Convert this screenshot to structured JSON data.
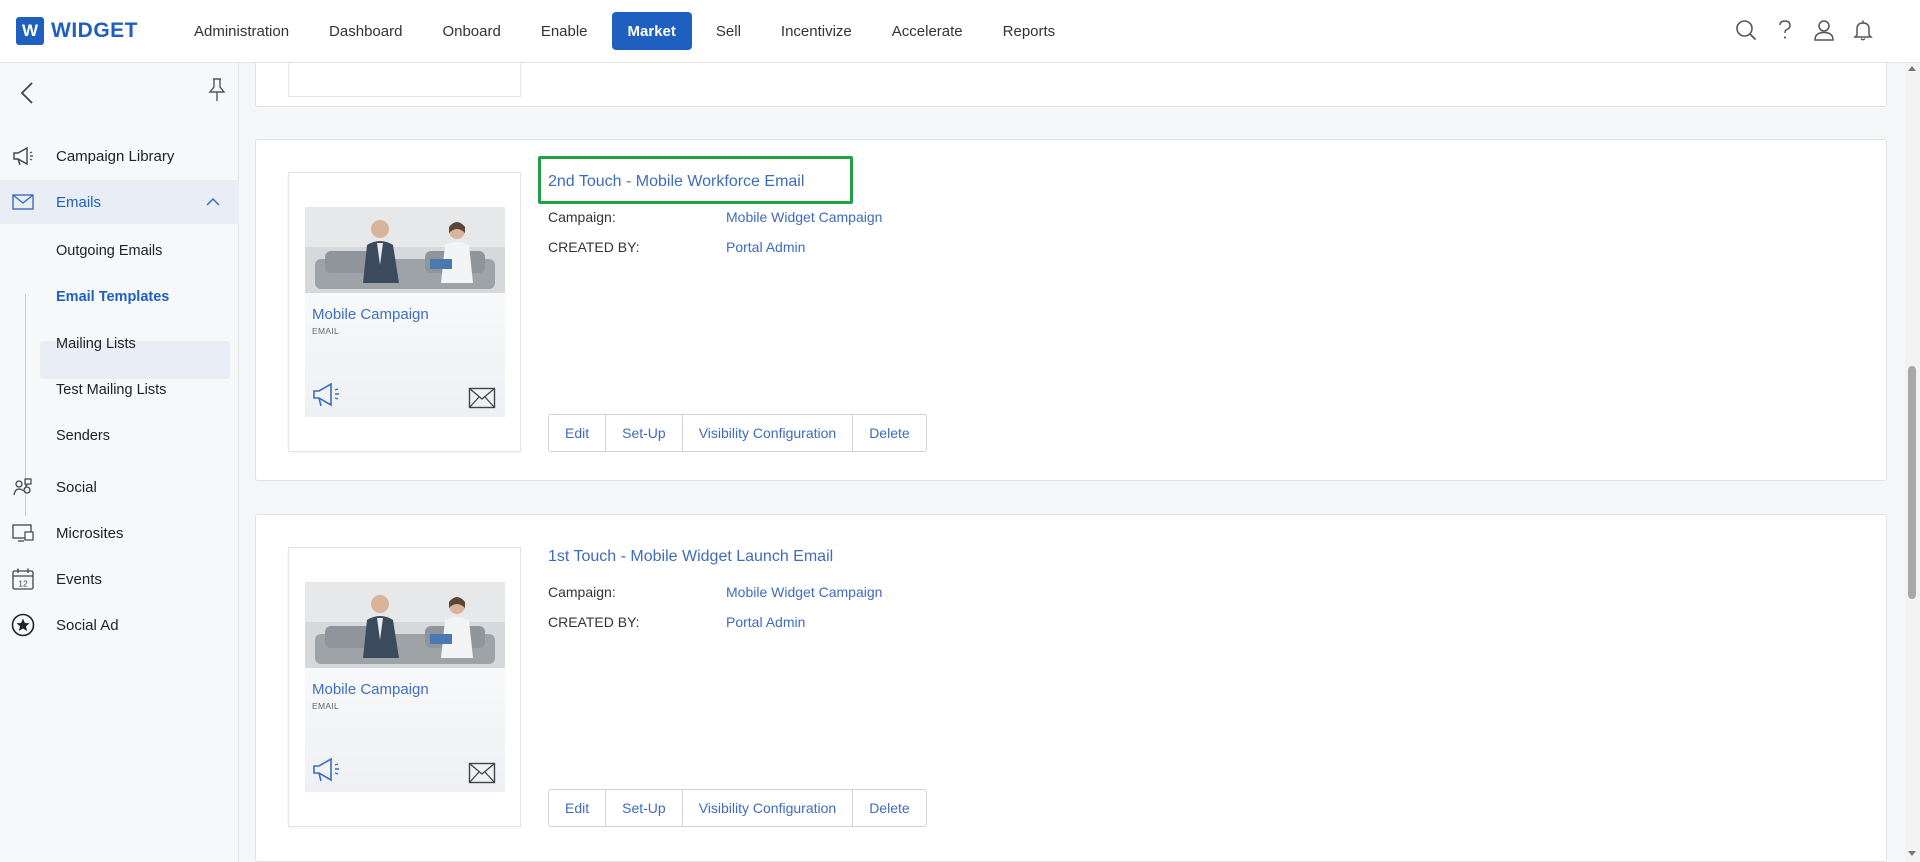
{
  "brand": {
    "badge": "W",
    "name": "WIDGET",
    "color": "#1f5fbf"
  },
  "nav": {
    "items": [
      {
        "label": "Administration",
        "active": false
      },
      {
        "label": "Dashboard",
        "active": false
      },
      {
        "label": "Onboard",
        "active": false
      },
      {
        "label": "Enable",
        "active": false
      },
      {
        "label": "Market",
        "active": true
      },
      {
        "label": "Sell",
        "active": false
      },
      {
        "label": "Incentivize",
        "active": false
      },
      {
        "label": "Accelerate",
        "active": false
      },
      {
        "label": "Reports",
        "active": false
      }
    ],
    "icons": [
      "search-icon",
      "help-icon",
      "user-icon",
      "bell-icon"
    ]
  },
  "sidebar": {
    "items": [
      {
        "label": "Campaign Library",
        "icon": "megaphone-icon"
      },
      {
        "label": "Emails",
        "icon": "envelope-icon",
        "expanded": true
      },
      {
        "label": "Social",
        "icon": "social-icon"
      },
      {
        "label": "Microsites",
        "icon": "microsite-icon"
      },
      {
        "label": "Events",
        "icon": "calendar-icon",
        "icon_text": "12"
      },
      {
        "label": "Social Ad",
        "icon": "star-badge-icon"
      }
    ],
    "email_subitems": [
      {
        "label": "Outgoing Emails",
        "active": false
      },
      {
        "label": "Email Templates",
        "active": true
      },
      {
        "label": "Mailing Lists",
        "active": false
      },
      {
        "label": "Test Mailing Lists",
        "active": false
      },
      {
        "label": "Senders",
        "active": false
      }
    ]
  },
  "templates": [
    {
      "title": "2nd Touch - Mobile Workforce Email",
      "highlighted": true,
      "thumb_title": "Mobile Campaign",
      "thumb_type": "EMAIL",
      "campaign_label": "Campaign:",
      "campaign_value": "Mobile Widget Campaign",
      "created_label": "CREATED BY:",
      "created_value": "Portal Admin",
      "actions": [
        "Edit",
        "Set-Up",
        "Visibility Configuration",
        "Delete"
      ]
    },
    {
      "title": "1st Touch - Mobile Widget Launch Email",
      "highlighted": false,
      "thumb_title": "Mobile Campaign",
      "thumb_type": "EMAIL",
      "campaign_label": "Campaign:",
      "campaign_value": "Mobile Widget Campaign",
      "created_label": "CREATED BY:",
      "created_value": "Portal Admin",
      "actions": [
        "Edit",
        "Set-Up",
        "Visibility Configuration",
        "Delete"
      ]
    }
  ],
  "colors": {
    "accent": "#1f5fbf",
    "link": "#3e6bc0",
    "highlight_border": "#22a046"
  }
}
